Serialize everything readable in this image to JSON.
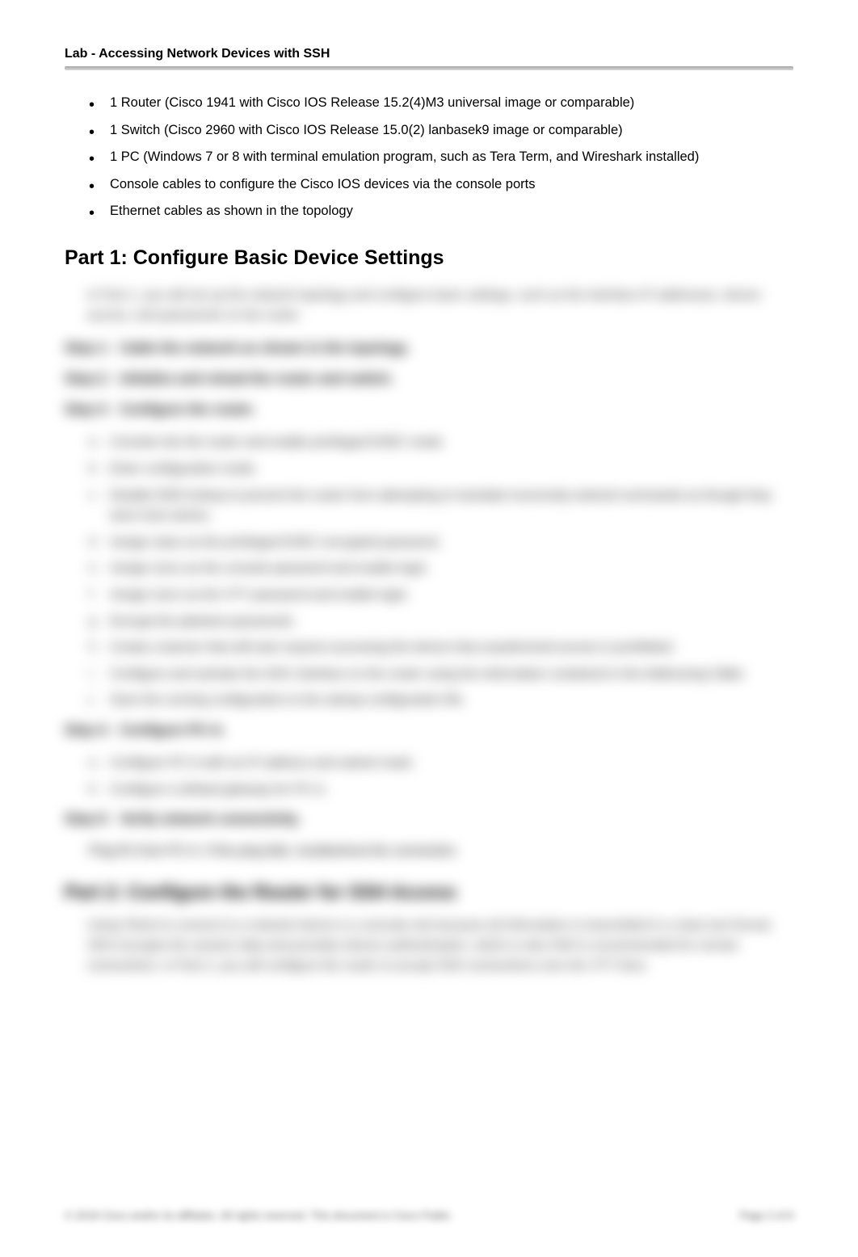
{
  "header": {
    "title": "Lab - Accessing Network Devices with SSH"
  },
  "resources": {
    "items": [
      "1 Router (Cisco 1941 with Cisco IOS Release 15.2(4)M3 universal image or comparable)",
      "1 Switch (Cisco 2960 with Cisco IOS Release 15.0(2) lanbasek9 image or comparable)",
      "1 PC (Windows 7 or 8 with terminal emulation program, such as Tera Term, and Wireshark installed)",
      "Console cables to configure the Cisco IOS devices via the console ports",
      "Ethernet cables as shown in the topology"
    ]
  },
  "part1": {
    "heading": "Part 1:   Configure Basic Device Settings",
    "intro": "In Part 1, you will set up the network topology and configure basic settings, such as the interface IP addresses, device access, and passwords on the router.",
    "steps": [
      {
        "label": "Step 1:",
        "title": "Cable the network as shown in the topology."
      },
      {
        "label": "Step 2:",
        "title": "Initialize and reload the router and switch."
      },
      {
        "label": "Step 3:",
        "title": "Configure the router."
      },
      {
        "label": "Step 4:",
        "title": "Configure PC-A."
      },
      {
        "label": "Step 5:",
        "title": "Verify network connectivity."
      }
    ],
    "step3_items": [
      "Console into the router and enable privileged EXEC mode.",
      "Enter configuration mode.",
      "Disable DNS lookup to prevent the router from attempting to translate incorrectly entered commands as though they were host names.",
      "Assign class as the privileged EXEC encrypted password.",
      "Assign cisco as the console password and enable login.",
      "Assign cisco as the VTY password and enable login.",
      "Encrypt the plaintext passwords.",
      "Create a banner that will warn anyone accessing the device that unauthorized access is prohibited.",
      "Configure and activate the G0/1 interface on the router using the information contained in the Addressing Table.",
      "Save the running configuration to the startup configuration file."
    ],
    "step4_items": [
      "Configure PC-A with an IP address and subnet mask.",
      "Configure a default gateway for PC-A."
    ],
    "step5_para": "Ping R1 from PC-A. If the ping fails, troubleshoot the connection."
  },
  "part2": {
    "heading": "Part 2:   Configure the Router for SSH Access",
    "intro": "Using Telnet to connect to a network device is a security risk because all information is transmitted in a clear text format. SSH encrypts the session data and provides device authentication, which is why SSH is recommended for remote connections. In Part 2, you will configure the router to accept SSH connections over the VTY lines."
  },
  "footer": {
    "left": "© 2018 Cisco and/or its affiliates. All rights reserved. This document is Cisco Public.",
    "right": "Page 2 of 8"
  }
}
